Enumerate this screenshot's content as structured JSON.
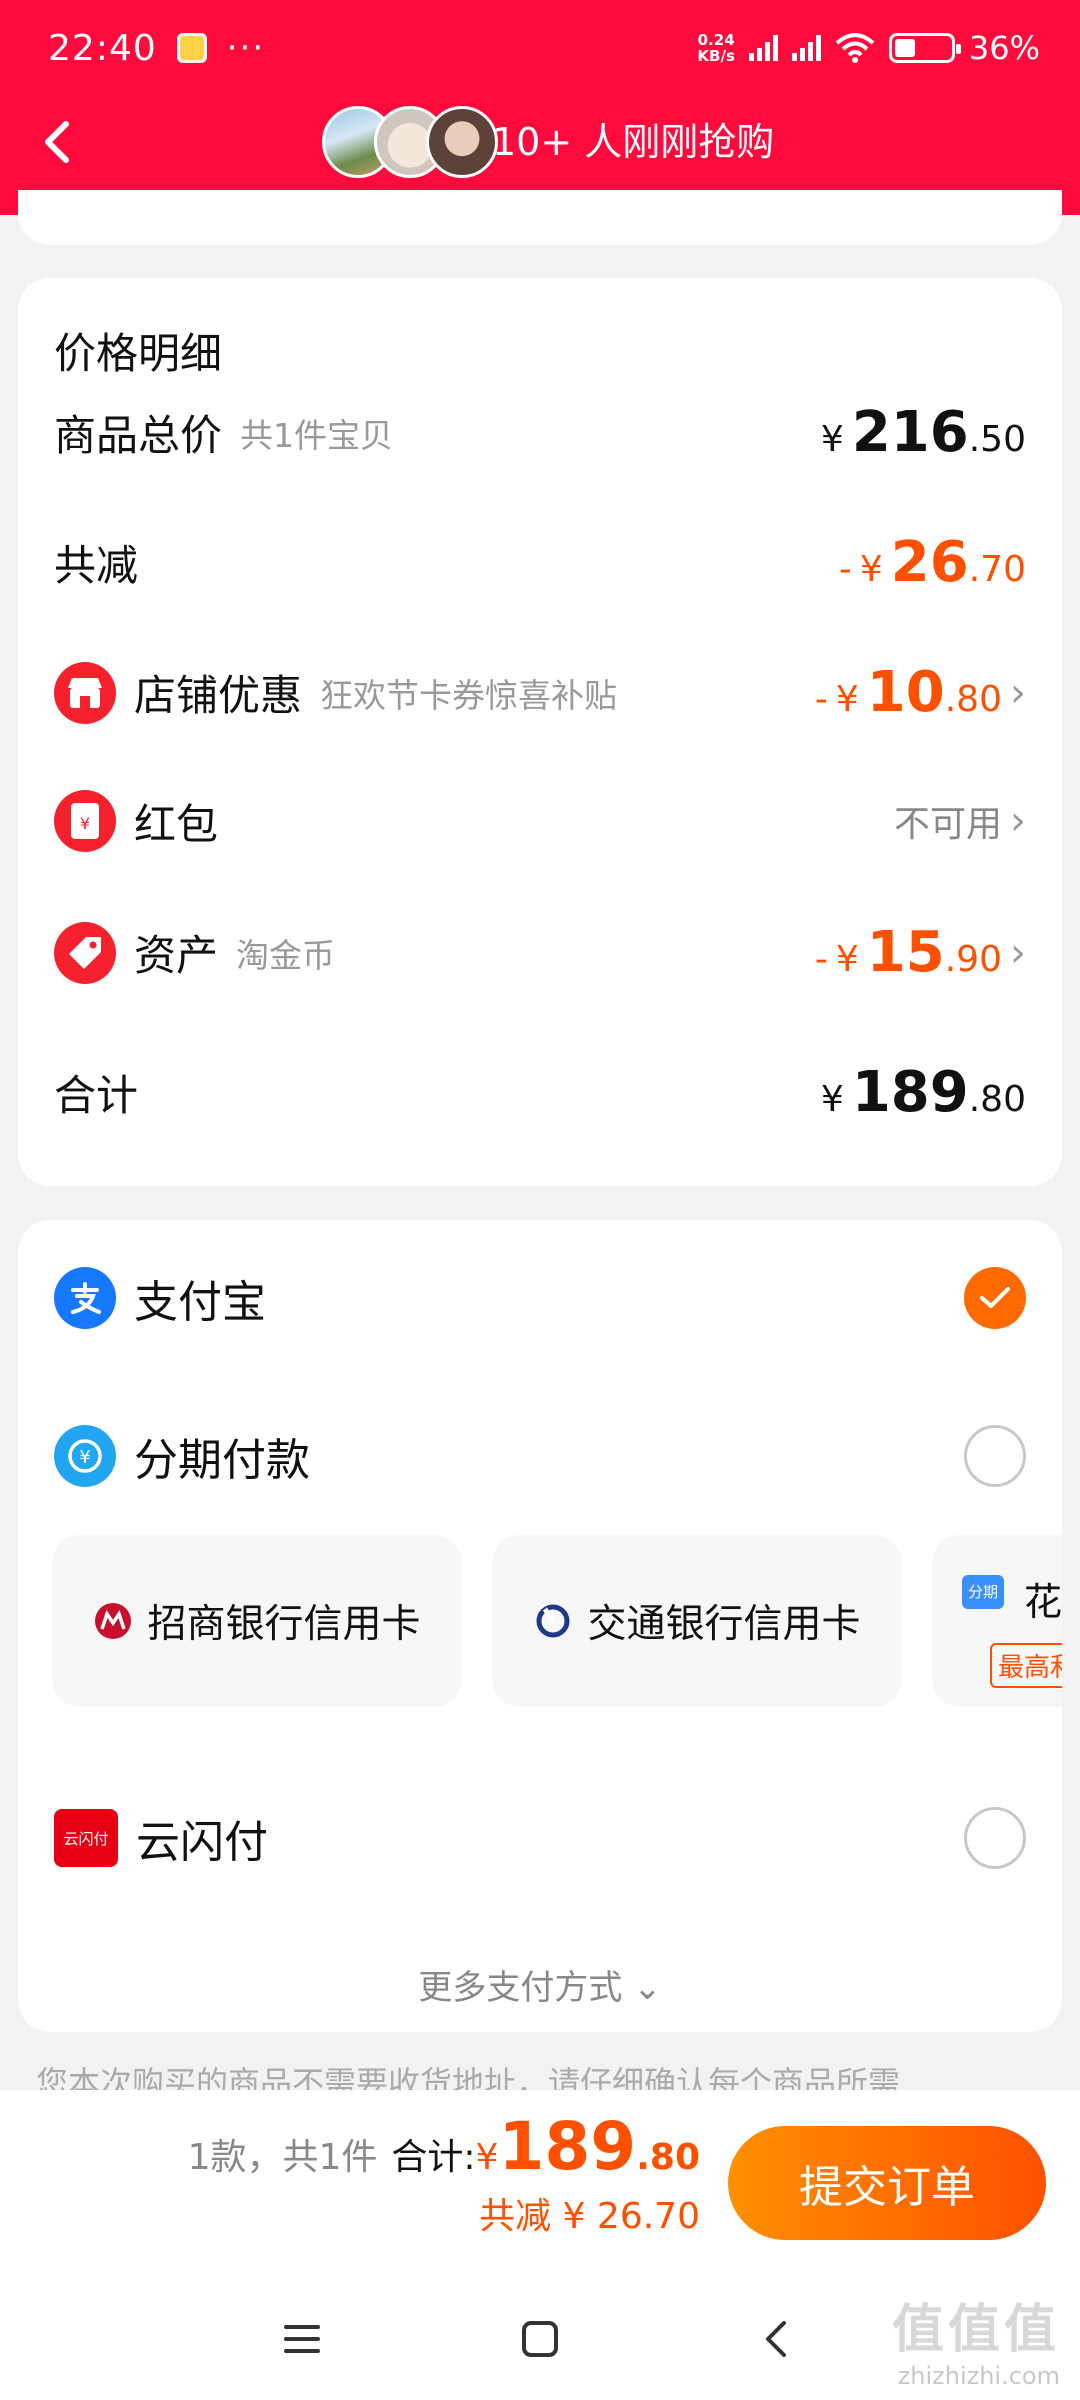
{
  "status_bar": {
    "time": "22:40",
    "net_speed_top": "0.24",
    "net_speed_bottom": "KB/s",
    "battery": "36%"
  },
  "header": {
    "buyers_text": "10+ 人刚刚抢购"
  },
  "price_detail": {
    "title": "价格明细",
    "items_total": {
      "label": "商品总价",
      "sub": "共1件宝贝",
      "currency": "¥",
      "int": "216",
      "dec": ".50"
    },
    "discount_total": {
      "label": "共减",
      "sign": "-",
      "currency": "¥",
      "int": "26",
      "dec": ".70"
    },
    "shop_coupon": {
      "label": "店铺优惠",
      "sub": "狂欢节卡券惊喜补贴",
      "sign": "-",
      "currency": "¥",
      "int": "10",
      "dec": ".80"
    },
    "red_packet": {
      "label": "红包",
      "status": "不可用"
    },
    "assets": {
      "label": "资产",
      "sub": "淘金币",
      "sign": "-",
      "currency": "¥",
      "int": "15",
      "dec": ".90"
    },
    "total": {
      "label": "合计",
      "currency": "¥",
      "int": "189",
      "dec": ".80"
    }
  },
  "payment": {
    "alipay": {
      "label": "支付宝",
      "checked": true
    },
    "installment": {
      "label": "分期付款",
      "checked": false
    },
    "banks": [
      "招商银行信用卡",
      "交通银行信用卡"
    ],
    "huabei": {
      "label": "花",
      "badge": "最高和",
      "fq_badge": "分期"
    },
    "unionpay": {
      "label": "云闪付",
      "logo_text": "云闪付",
      "checked": false
    },
    "more": "更多支付方式"
  },
  "notice": "您本次购买的商品不需要收货地址，请仔细确认每个商品所需",
  "bottom": {
    "count": "1款，共1件",
    "total_label": "合计:",
    "currency": "¥",
    "total_int": "189",
    "total_dec": ".80",
    "discount": "共减 ¥ 26.70",
    "submit": "提交订单"
  },
  "watermark": {
    "big": "值值值",
    "small": "zhizhizhi.com"
  },
  "colors": {
    "brand_red": "#ff0a3c",
    "accent_orange": "#ff5000"
  }
}
